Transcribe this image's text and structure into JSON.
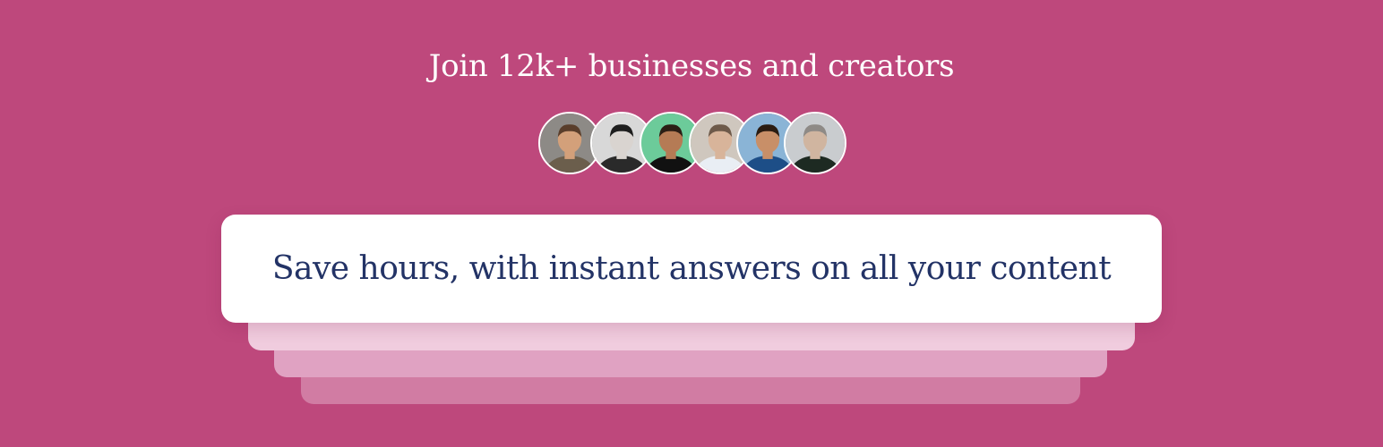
{
  "headline": "Join 12k+ businesses and creators",
  "avatars": [
    {
      "icon": "person-avatar-icon",
      "bg": "#8D8A86",
      "skin": "#D3A07A",
      "hair": "#5A3E2B",
      "shirt": "#6B5E4C"
    },
    {
      "icon": "person-avatar-icon",
      "bg": "#D8D8D8",
      "skin": "#D9D4D0",
      "hair": "#1E1E1E",
      "shirt": "#2A2A2A"
    },
    {
      "icon": "person-avatar-icon",
      "bg": "#6CCB9A",
      "skin": "#B57B55",
      "hair": "#2B1E15",
      "shirt": "#111111"
    },
    {
      "icon": "person-avatar-icon",
      "bg": "#CFC7BE",
      "skin": "#D8B49A",
      "hair": "#6E5A4A",
      "shirt": "#E9EEF4"
    },
    {
      "icon": "person-avatar-icon",
      "bg": "#8AB4D6",
      "skin": "#C88F68",
      "hair": "#2A1C12",
      "shirt": "#1D4E87"
    },
    {
      "icon": "person-avatar-icon",
      "bg": "#C9CCCF",
      "skin": "#D0B5A0",
      "hair": "#8E8A86",
      "shirt": "#1D2A22"
    }
  ],
  "card": {
    "text": "Save hours, with instant answers on all your content"
  },
  "colors": {
    "background": "#BE487C",
    "card_text": "#233366",
    "card_bg": "#FFFFFF"
  }
}
